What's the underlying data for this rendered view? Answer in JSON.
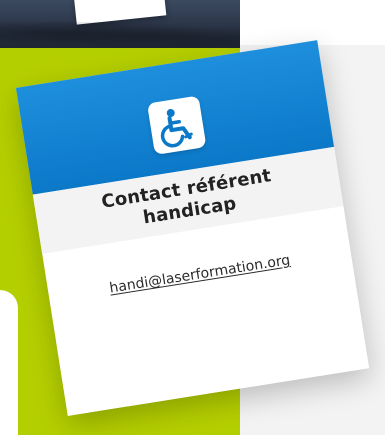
{
  "card": {
    "title_line1": "Contact référent",
    "title_line2": "handicap",
    "email": "handi@laserformation.org",
    "icon": "wheelchair-icon"
  },
  "colors": {
    "green": "#b4cf00",
    "blue": "#0b78c8",
    "light_gray": "#f3f3f3"
  }
}
